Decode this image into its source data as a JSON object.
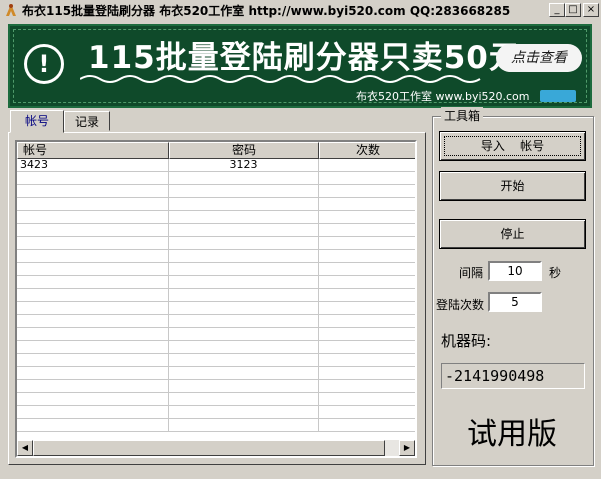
{
  "window": {
    "title": "布衣115批量登陆刷分器  布衣520工作室 http://www.byi520.com  QQ:283668285",
    "controls": [
      "_",
      "□",
      "×"
    ]
  },
  "banner": {
    "headline": "115批量登陆刷分器只卖50元",
    "cta": "点击查看",
    "subtext": "布衣520工作室 www.byi520.com",
    "warning_glyph": "!"
  },
  "tabs": [
    {
      "label": "帐号",
      "active": true
    },
    {
      "label": "记录",
      "active": false
    }
  ],
  "table": {
    "columns": [
      "帐号",
      "密码",
      "次数"
    ],
    "rows": [
      [
        "3423",
        "3123",
        ""
      ]
    ]
  },
  "toolbox": {
    "title": "工具箱",
    "import_label": "导入    帐号",
    "start_label": "开始",
    "stop_label": "停止",
    "interval_label": "间隔",
    "interval_value": "10",
    "interval_unit": "秒",
    "login_count_label": "登陆次数",
    "login_count_value": "5",
    "machine_code_label": "机器码:",
    "machine_code_value": "-2141990498",
    "trial_label": "试用版"
  },
  "colors": {
    "banner_bg": "#0f4a2a",
    "face": "#d4d0c8",
    "active_tab_text": "#000080"
  }
}
